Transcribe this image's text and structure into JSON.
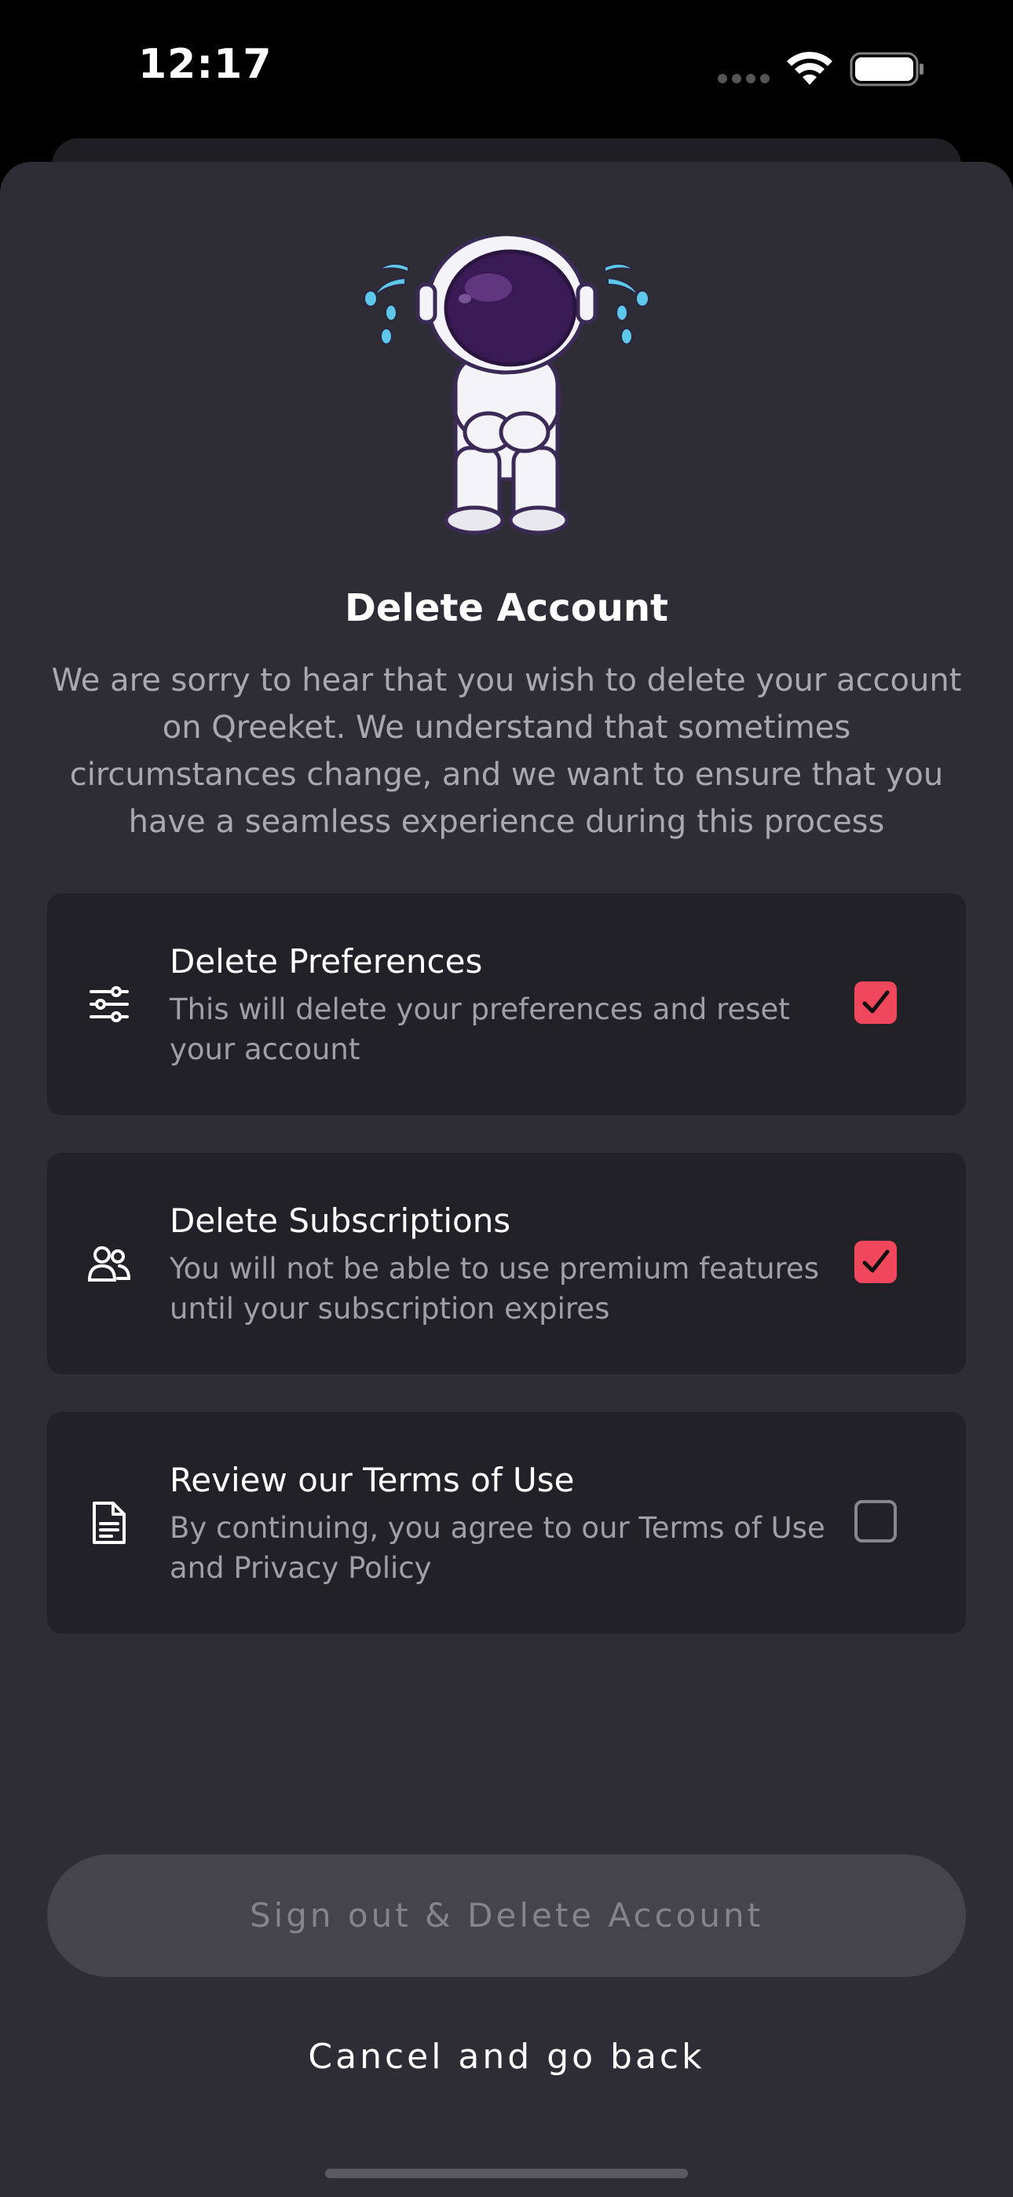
{
  "status_bar": {
    "time": "12:17",
    "icons": [
      "signal-icon",
      "wifi-icon",
      "battery-icon"
    ]
  },
  "header": {
    "illustration": "crying-astronaut-illustration",
    "title": "Delete Account",
    "description": "We are sorry to hear that you wish to delete your account on Qreeket. We understand that sometimes circumstances change, and we want to ensure that you have a seamless experience during this process"
  },
  "options": [
    {
      "icon": "sliders-icon",
      "title": "Delete Preferences",
      "subtitle": "This will delete your preferences and reset your account",
      "checked": true
    },
    {
      "icon": "users-icon",
      "title": "Delete Subscriptions",
      "subtitle": "You will not be able to use premium features until your subscription expires",
      "checked": true
    },
    {
      "icon": "document-icon",
      "title": "Review our Terms of Use",
      "subtitle": "By continuing, you agree to our Terms of Use and Privacy Policy",
      "checked": false
    }
  ],
  "actions": {
    "delete_label": "Sign out & Delete Account",
    "delete_enabled": false,
    "cancel_label": "Cancel and go back"
  },
  "colors": {
    "background": "#2e2d36",
    "card": "#222128",
    "accent": "#f0475c",
    "disabled_button": "#45444d"
  }
}
